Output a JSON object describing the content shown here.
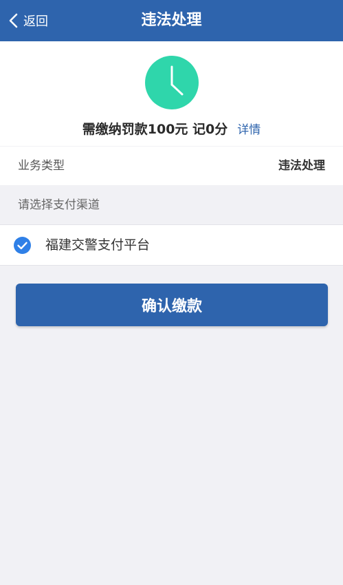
{
  "header": {
    "back_label": "返回",
    "title": "违法处理"
  },
  "summary": {
    "fine_text": "需缴纳罚款100元 记0分",
    "detail_link": "详情",
    "clock_color": "#2fd6ab"
  },
  "business": {
    "label": "业务类型",
    "value": "违法处理"
  },
  "payment": {
    "section_hint": "请选择支付渠道",
    "selected_option": "福建交警支付平台",
    "selected": true
  },
  "confirm_button": "确认缴款",
  "colors": {
    "brand_blue": "#2e64ad",
    "page_background": "#f1f1f5",
    "check_blue": "#2f80e7"
  }
}
